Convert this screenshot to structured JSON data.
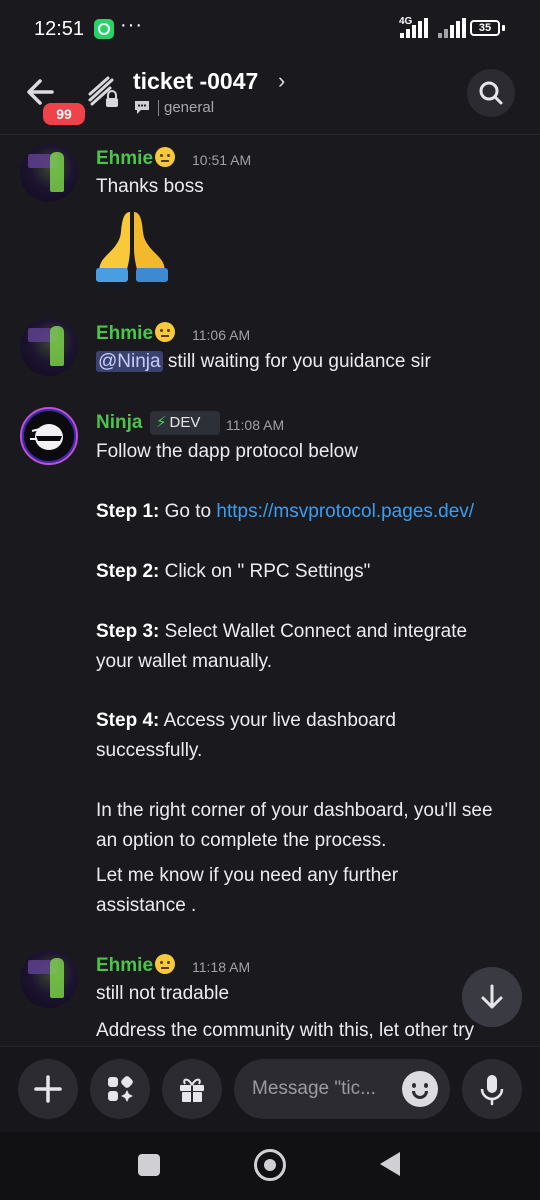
{
  "status_bar": {
    "time": "12:51",
    "dots": "···",
    "network": "4G",
    "battery": "35"
  },
  "header": {
    "unread_count": "99",
    "title": "ticket -0047",
    "chevron": "›",
    "subtitle": "general"
  },
  "messages": [
    {
      "author": "Ehmie",
      "time": "10:51 AM",
      "lines": [
        "Thanks boss"
      ],
      "emoji": "folded-hands"
    },
    {
      "author": "Ehmie",
      "time": "11:06 AM",
      "mention": "@Ninja",
      "text_after_mention": " still waiting for you guidance sir"
    },
    {
      "author": "Ninja",
      "time": "11:08 AM",
      "tag": "DEV",
      "intro": "Follow the dapp protocol below",
      "step1_label": "Step 1:",
      "step1_text": " Go to ",
      "step1_link": "https://msvprotocol.pages.dev/",
      "step2_label": "Step 2:",
      "step2_text": " Click on \" RPC Settings\"",
      "step3_label": "Step 3:",
      "step3_text": " Select Wallet Connect  and integrate",
      "step3_text2": "your wallet manually.",
      "step4_label": "Step 4:",
      "step4_text": " Access your live dashboard",
      "step4_text2": "successfully.",
      "outro1": "In the right corner of your dashboard, you'll see",
      "outro2": "an option to complete the process.",
      "outro3": "Let me know if you need any further",
      "outro4": "assistance ."
    },
    {
      "author": "Ehmie",
      "time": "11:18 AM",
      "lines": [
        "still not tradable",
        "Address the community with this, let other try"
      ]
    }
  ],
  "composer": {
    "placeholder": "Message \"tic..."
  },
  "colors": {
    "background": "#1a1a1e",
    "author_green": "#4cc44c",
    "link_blue": "#3a9ef0",
    "badge_red": "#f0424a"
  },
  "icons": [
    "back-arrow-icon",
    "threads-channel-icon",
    "chevron-right-icon",
    "chat-bubble-icon",
    "search-icon",
    "plus-icon",
    "apps-icon",
    "gift-icon",
    "emoji-icon",
    "microphone-icon",
    "arrow-down-icon"
  ]
}
